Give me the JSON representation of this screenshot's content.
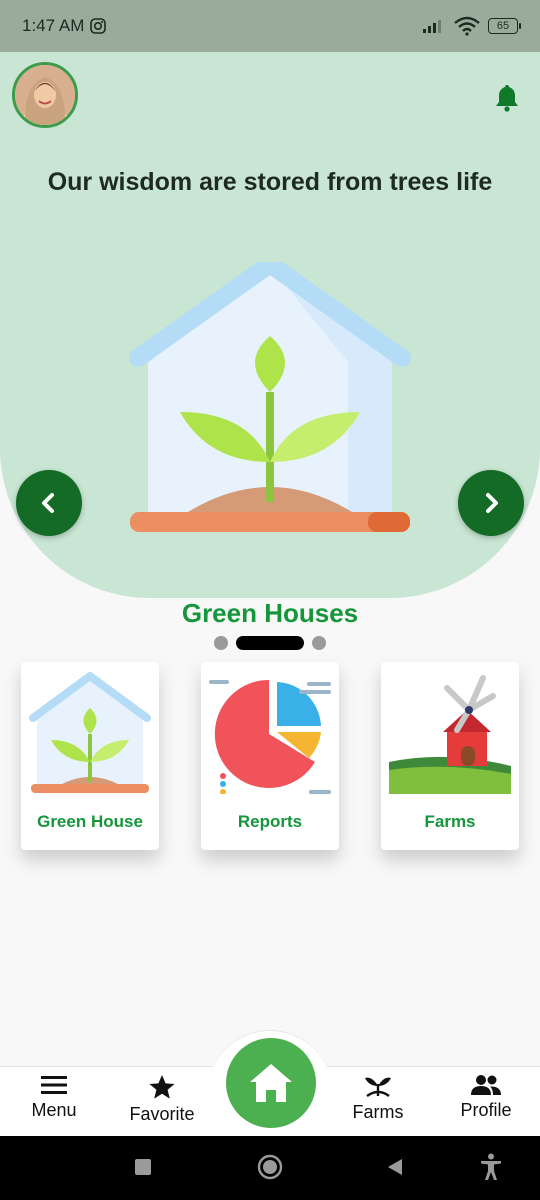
{
  "status_bar": {
    "time": "1:47 AM",
    "battery": "65"
  },
  "hero": {
    "title": "Our wisdom are stored from trees life",
    "slide_caption": "Green Houses"
  },
  "cards": [
    {
      "label": "Green House",
      "icon": "greenhouse-icon"
    },
    {
      "label": "Reports",
      "icon": "pie-chart-icon"
    },
    {
      "label": "Farms",
      "icon": "windmill-farm-icon"
    }
  ],
  "bottom_nav": {
    "menu": "Menu",
    "favorite": "Favorite",
    "farms": "Farms",
    "profile": "Profile"
  },
  "colors": {
    "hero_bg": "#c8e6d3",
    "accent_green": "#15963a",
    "dark_green": "#136b26",
    "home_green": "#4caf50"
  }
}
